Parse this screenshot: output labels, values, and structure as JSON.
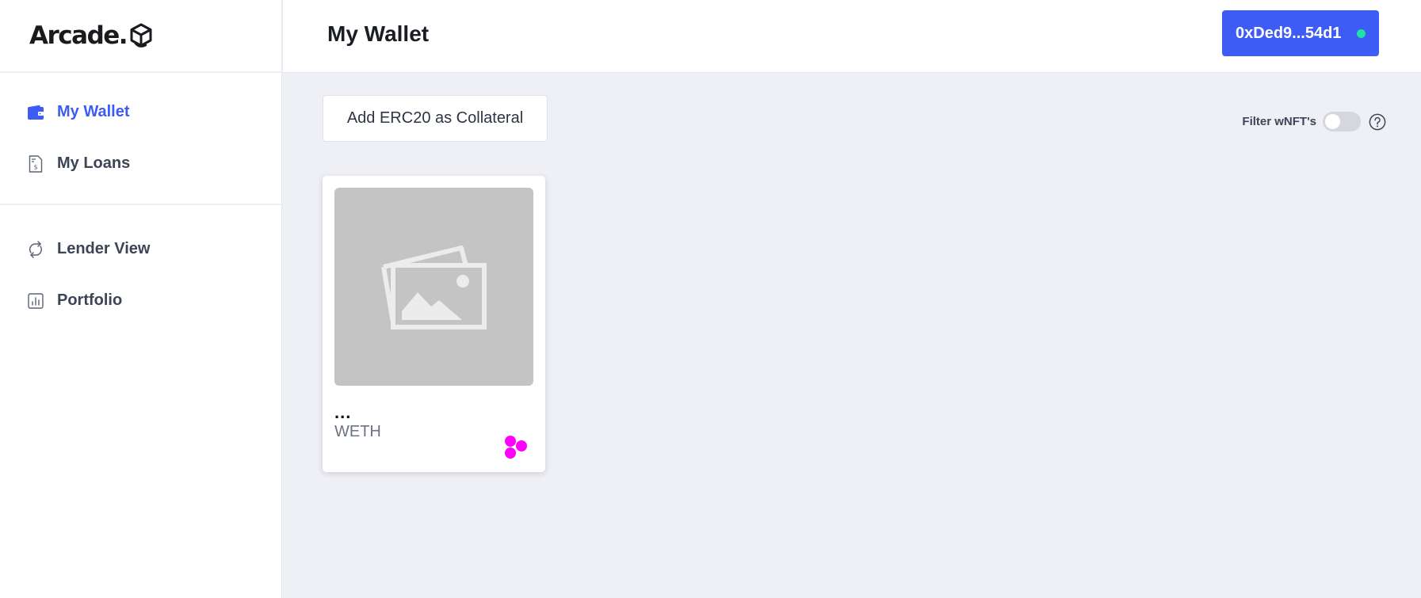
{
  "brand": {
    "logo_text": "Arcade."
  },
  "sidebar": {
    "primary_items": [
      {
        "label": "My Wallet",
        "icon": "wallet-icon",
        "active": true
      },
      {
        "label": "My Loans",
        "icon": "loan-document-icon",
        "active": false
      }
    ],
    "secondary_items": [
      {
        "label": "Lender View",
        "icon": "swap-arrows-icon",
        "active": false
      },
      {
        "label": "Portfolio",
        "icon": "bar-chart-icon",
        "active": false
      }
    ]
  },
  "header": {
    "title": "My Wallet",
    "wallet_address": "0xDed9...54d1",
    "wallet_status": "connected"
  },
  "toolbar": {
    "add_erc20_label": "Add ERC20 as Collateral",
    "filter_label": "Filter wNFT's",
    "filter_enabled": false,
    "help_icon": "question-circle-icon"
  },
  "nfts": [
    {
      "name": "...",
      "symbol": "WETH",
      "image": "placeholder-image-icon",
      "badge": "token-badge-icon"
    }
  ],
  "colors": {
    "accent": "#3d5cf5",
    "status_online": "#1ee3a3",
    "badge": "#ff00ff",
    "background": "#eff0f5"
  }
}
